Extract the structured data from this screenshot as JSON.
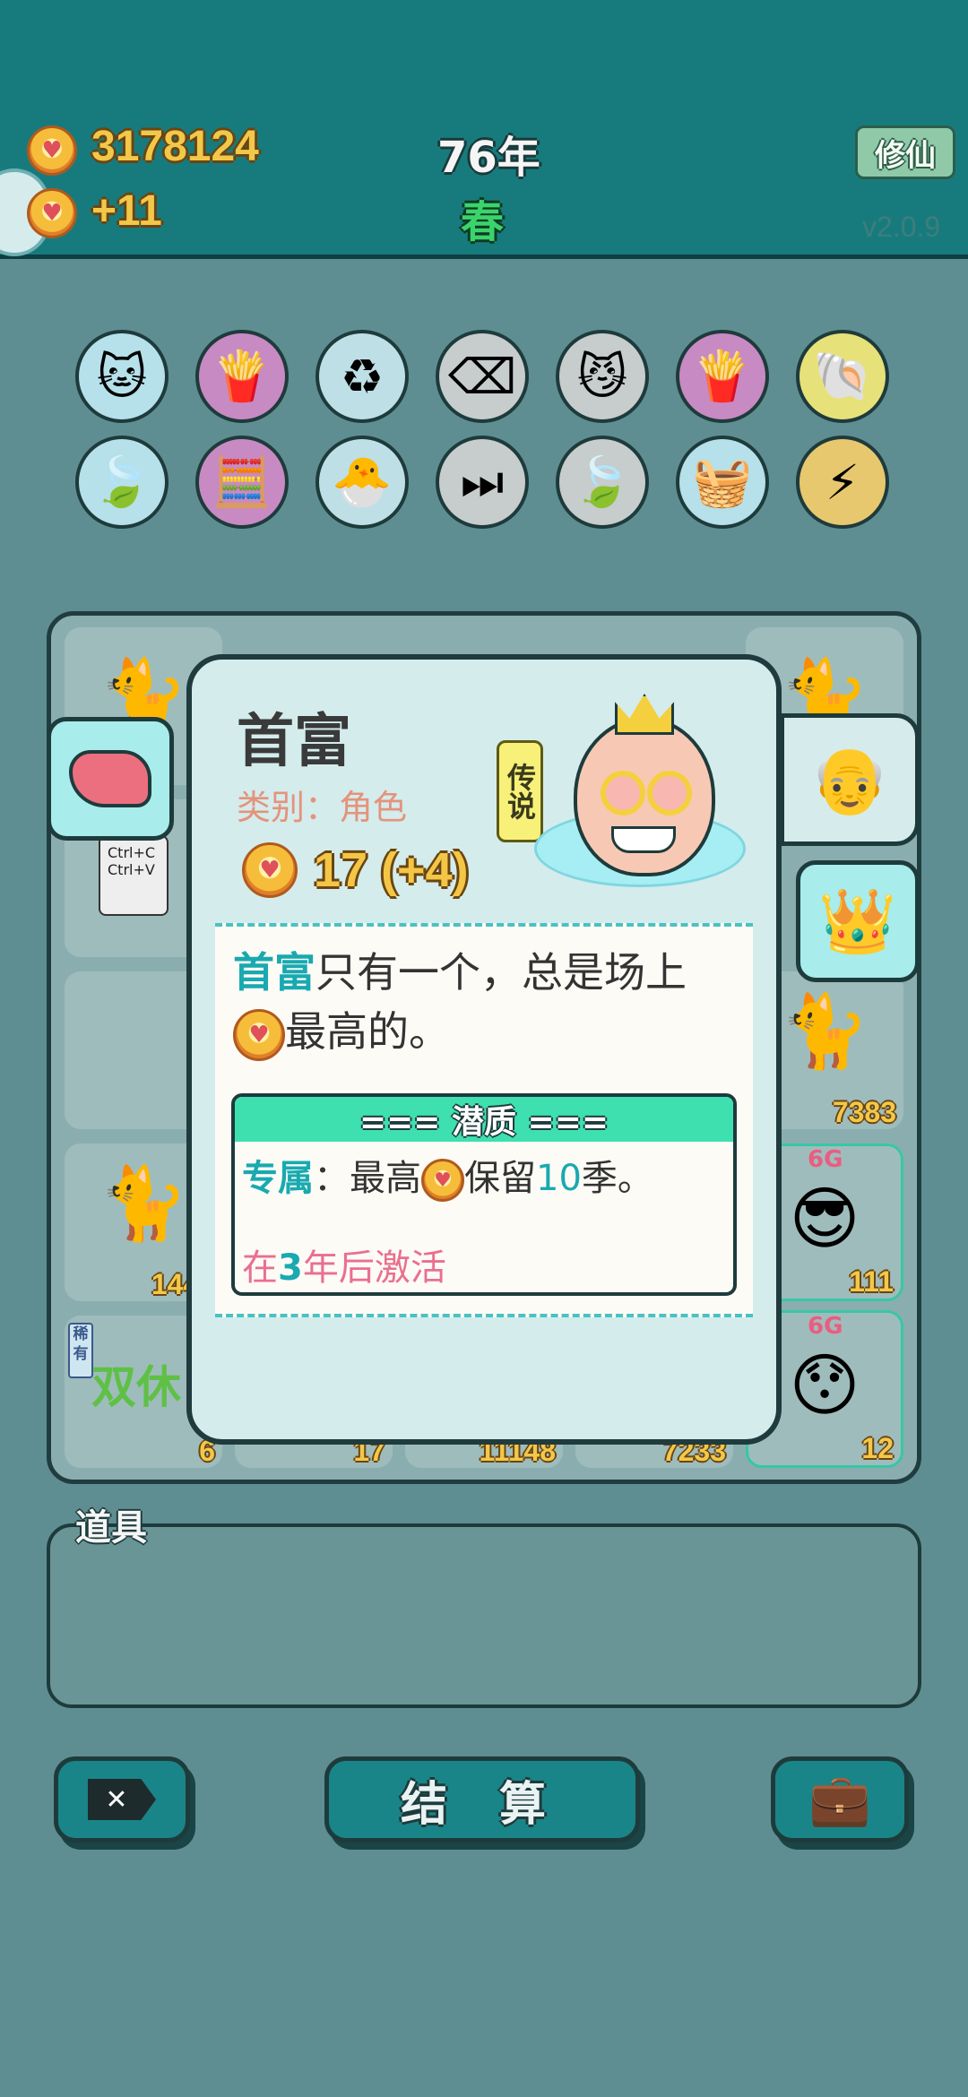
{
  "header": {
    "coins": "3178124",
    "income": "+11",
    "year": "76年",
    "season": "春",
    "mode_button": "修仙",
    "version": "v2.0.9"
  },
  "board": {
    "cell_values": [
      "7383",
      "1447",
      "111",
      "6",
      "17",
      "11148",
      "7233",
      "12"
    ],
    "rare_tag": "稀有",
    "rare_text": "双休",
    "badge_6g": "6G",
    "copy_card": "Ctrl+C\nCtrl+V"
  },
  "card": {
    "title": "首富",
    "category": "类别：角色",
    "rarity_tag": "传说",
    "value": "17 (+4)",
    "desc_highlight": "首富",
    "desc_part1": "只有一个，总是场上",
    "desc_part2": "最高的。",
    "trait_header": "=== 潜质 ===",
    "trait_prefix": "专属",
    "trait_colon": "：最高",
    "trait_mid": "保留",
    "trait_num": "10",
    "trait_end": "季。",
    "activate_pre": "在",
    "activate_num": "3",
    "activate_post": "年后激活"
  },
  "items": {
    "label": "道具"
  },
  "buttons": {
    "settle": "结 算"
  }
}
